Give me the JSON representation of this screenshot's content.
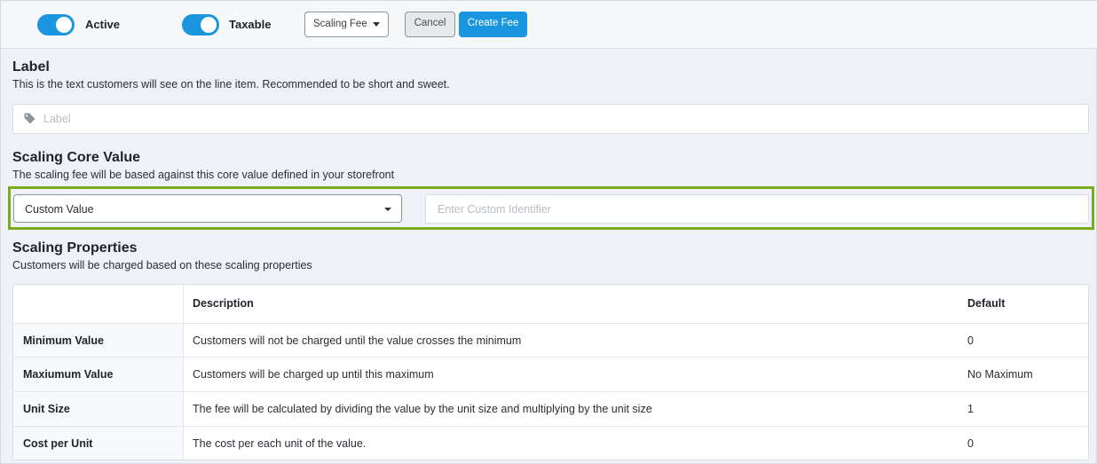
{
  "toolbar": {
    "active_label": "Active",
    "taxable_label": "Taxable",
    "fee_type_selected": "Scaling Fee",
    "cancel_label": "Cancel",
    "create_label": "Create Fee",
    "accent_color": "#1a96e0"
  },
  "label_section": {
    "title": "Label",
    "description": "This is the text customers will see on the line item. Recommended to be short and sweet.",
    "input_placeholder": "Label",
    "input_value": "",
    "icon": "tag-icon"
  },
  "core_value_section": {
    "title": "Scaling Core Value",
    "description": "The scaling fee will be based against this core value defined in your storefront",
    "selected_value": "Custom Value",
    "identifier_placeholder": "Enter Custom Identifier",
    "identifier_value": "",
    "highlight_color": "#7aab1e"
  },
  "properties_section": {
    "title": "Scaling Properties",
    "description": "Customers will be charged based on these scaling properties",
    "columns": [
      "",
      "Description",
      "Default"
    ],
    "rows": [
      {
        "name": "Minimum Value",
        "description": "Customers will not be charged until the value crosses the minimum",
        "default": "0"
      },
      {
        "name": "Maxiumum Value",
        "description": "Customers will be charged up until this maximum",
        "default": "No Maximum"
      },
      {
        "name": "Unit Size",
        "description": "The fee will be calculated by dividing the value by the unit size and multiplying by the unit size",
        "default": "1"
      },
      {
        "name": "Cost per Unit",
        "description": "The cost per each unit of the value.",
        "default": "0"
      }
    ]
  }
}
